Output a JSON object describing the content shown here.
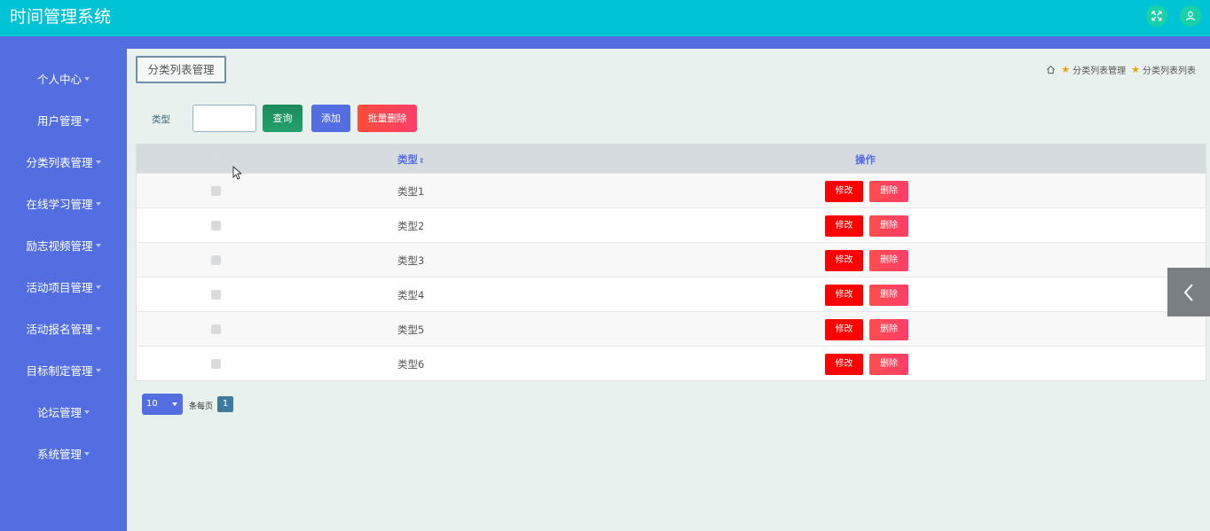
{
  "header": {
    "title": "时间管理系统",
    "icons": [
      "fullscreen-icon",
      "user-icon"
    ],
    "colors": {
      "topbar": "#00c4d6",
      "icon_bg": "#19d1a6"
    }
  },
  "sidebar": {
    "items": [
      {
        "label": "个人中心"
      },
      {
        "label": "用户管理"
      },
      {
        "label": "分类列表管理"
      },
      {
        "label": "在线学习管理"
      },
      {
        "label": "励志视频管理"
      },
      {
        "label": "活动项目管理"
      },
      {
        "label": "活动报名管理"
      },
      {
        "label": "目标制定管理"
      },
      {
        "label": "论坛管理"
      },
      {
        "label": "系统管理"
      }
    ]
  },
  "page": {
    "tab_label": "分类列表管理",
    "breadcrumb": [
      "分类列表管理",
      "分类列表列表"
    ]
  },
  "search": {
    "label": "类型",
    "value": "",
    "query_label": "查询",
    "add_label": "添加",
    "batch_delete_label": "批量删除"
  },
  "table": {
    "headers": {
      "type": "类型",
      "actions": "操作"
    },
    "rows": [
      {
        "type": "类型1",
        "edit": "修改",
        "delete": "删除"
      },
      {
        "type": "类型2",
        "edit": "修改",
        "delete": "删除"
      },
      {
        "type": "类型3",
        "edit": "修改",
        "delete": "删除"
      },
      {
        "type": "类型4",
        "edit": "修改",
        "delete": "删除"
      },
      {
        "type": "类型5",
        "edit": "修改",
        "delete": "删除"
      },
      {
        "type": "类型6",
        "edit": "修改",
        "delete": "删除"
      }
    ]
  },
  "pagination": {
    "page_size": "10",
    "per_page_label": "条每页",
    "current_page": "1"
  },
  "colors": {
    "primary": "#536ee0",
    "danger": "#ff0000",
    "success": "#1d8b5c"
  }
}
